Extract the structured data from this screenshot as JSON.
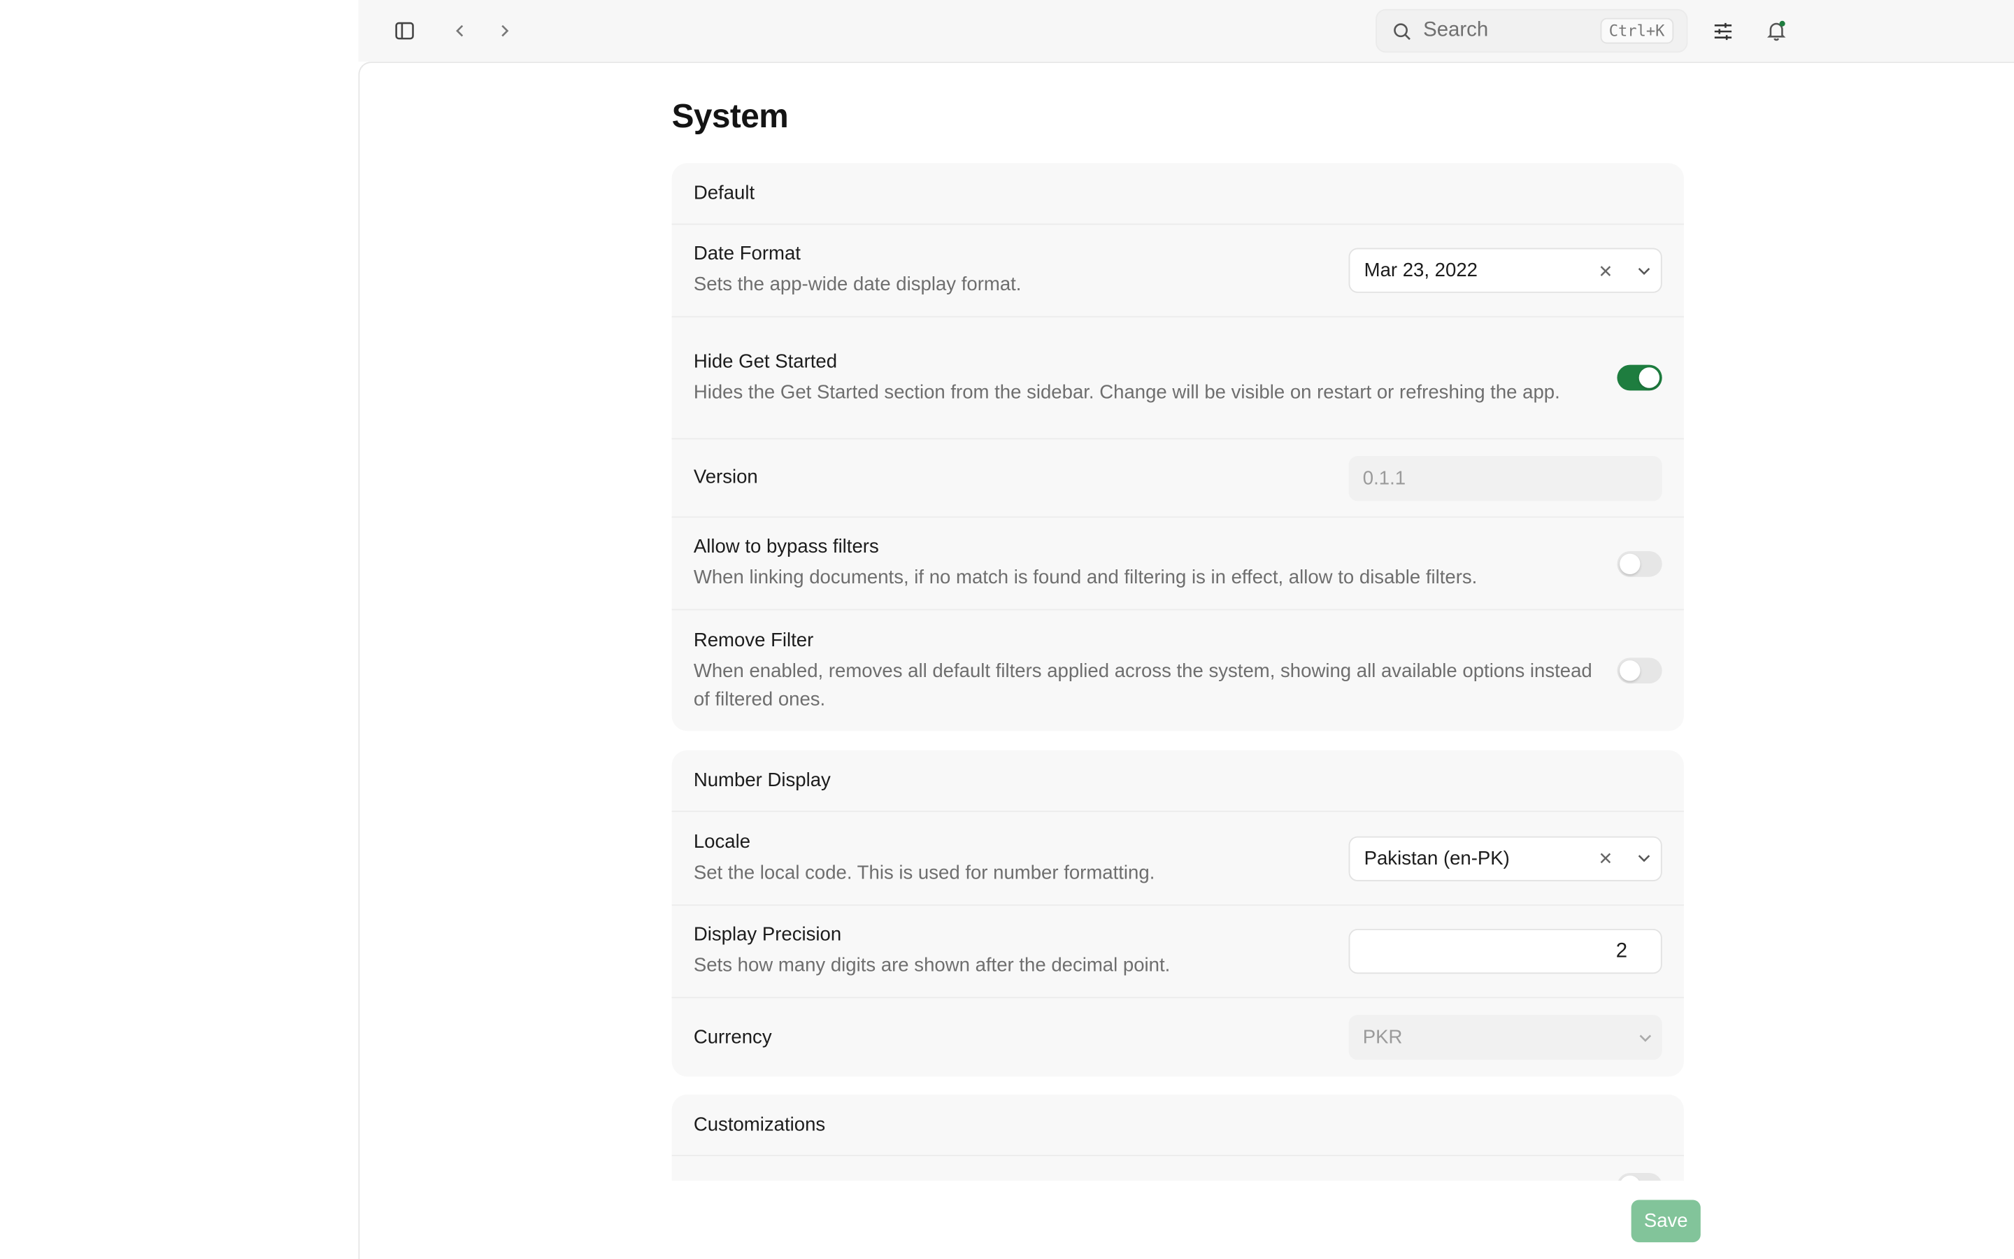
{
  "topbar": {
    "search_placeholder": "Search",
    "search_shortcut": "Ctrl+K",
    "icons": [
      "sidebar-toggle-icon",
      "chevron-left-icon",
      "chevron-right-icon",
      "search-icon",
      "sliders-icon",
      "bell-icon"
    ],
    "notification_dot_color": "#1e7d3f"
  },
  "page": {
    "title": "System"
  },
  "sections": {
    "default": {
      "title": "Default",
      "date_format": {
        "label": "Date Format",
        "description": "Sets the app-wide date display format.",
        "value": "Mar 23, 2022"
      },
      "hide_get_started": {
        "label": "Hide Get Started",
        "description": "Hides the Get Started section from the sidebar. Change will be visible on restart or refreshing the app.",
        "enabled": true
      },
      "version": {
        "label": "Version",
        "value": "0.1.1"
      },
      "allow_bypass_filters": {
        "label": "Allow to bypass filters",
        "description": "When linking documents, if no match is found and filtering is in effect, allow to disable filters.",
        "enabled": false
      },
      "remove_filter": {
        "label": "Remove Filter",
        "description": "When enabled, removes all default filters applied across the system, showing all available options instead of filtered ones.",
        "enabled": false
      }
    },
    "number_display": {
      "title": "Number Display",
      "locale": {
        "label": "Locale",
        "description": "Set the local code. This is used for number formatting.",
        "value": "Pakistan (en-PK)"
      },
      "display_precision": {
        "label": "Display Precision",
        "description": "Sets how many digits are shown after the decimal point.",
        "value": "2"
      },
      "currency": {
        "label": "Currency",
        "value": "PKR"
      }
    },
    "customizations": {
      "title": "Customizations"
    }
  },
  "actions": {
    "save_label": "Save"
  },
  "colors": {
    "toggle_on": "#1e7d3f",
    "save_button": "#82c49a"
  }
}
